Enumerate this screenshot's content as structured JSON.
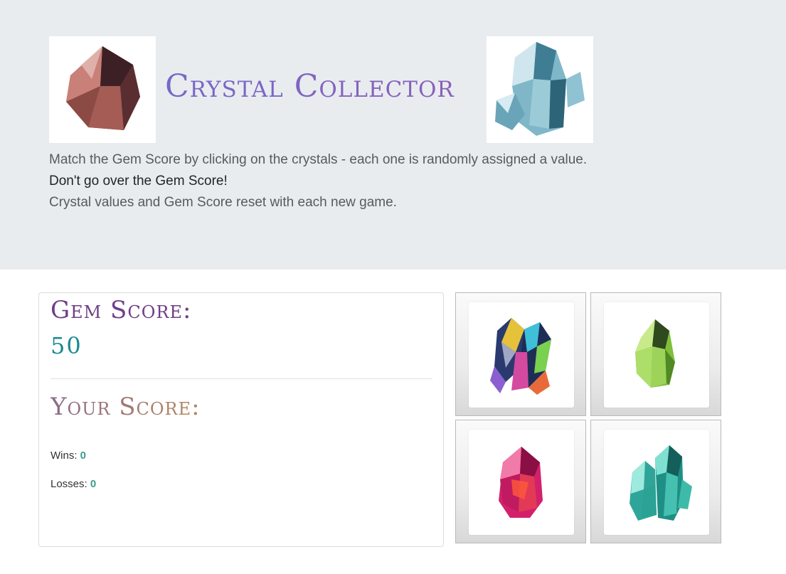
{
  "header": {
    "title": "Crystal Collector",
    "intro_line_1": "Match the Gem Score by clicking on the crystals - each one is randomly assigned a value.",
    "intro_line_2": "Don't go over the Gem Score!",
    "intro_line_3": "Crystal values and Gem Score reset with each new game."
  },
  "scoreboard": {
    "gem_score_label": "Gem Score:",
    "gem_score_value": "50",
    "your_score_label": "Your Score:",
    "your_score_value": "",
    "wins_label": "Wins:",
    "wins_value": "0",
    "losses_label": "Losses:",
    "losses_value": "0"
  },
  "crystals": [
    {
      "icon": "rainbow-crystal-icon",
      "color": "#3a4a8a"
    },
    {
      "icon": "green-crystal-icon",
      "color": "#7fbf3a"
    },
    {
      "icon": "pink-crystal-icon",
      "color": "#d4206a"
    },
    {
      "icon": "teal-crystal-icon",
      "color": "#2fa59a"
    }
  ],
  "colors": {
    "jumbotron_bg": "#e9ecef",
    "title": "#7569c9",
    "gem_score_label": "#6f3f86",
    "gem_score_value": "#1b8a8e",
    "stat_value": "#3f9a8a"
  }
}
